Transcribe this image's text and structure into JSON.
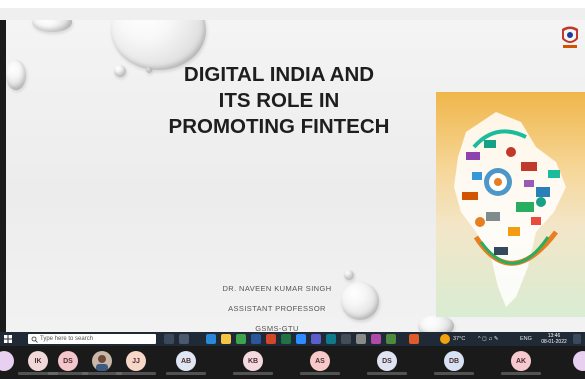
{
  "slide": {
    "title_lines": [
      "DIGITAL INDIA AND",
      "ITS ROLE IN",
      "PROMOTING FINTECH"
    ],
    "author_lines": [
      "DR. NAVEEN KUMAR SINGH",
      "ASSISTANT PROFESSOR",
      "GSMS-GTU"
    ]
  },
  "taskbar": {
    "search_placeholder": "Type here to search",
    "weather": "37°C",
    "tray_lang": "ENG",
    "time": "13:46",
    "date": "08-01-2022"
  },
  "participants": [
    {
      "initials": "IK",
      "color": "#f2d9d9"
    },
    {
      "initials": "DS",
      "color": "#f5c6cb"
    },
    {
      "initials": "",
      "color": "#c9b8a8"
    },
    {
      "initials": "JJ",
      "color": "#f7d7c8"
    },
    {
      "initials": "AB",
      "color": "#e1e6f5"
    },
    {
      "initials": "KB",
      "color": "#f5d9e0"
    },
    {
      "initials": "AS",
      "color": "#f7c9c9"
    },
    {
      "initials": "DS",
      "color": "#dfe4f2"
    },
    {
      "initials": "DB",
      "color": "#d8e2f5"
    },
    {
      "initials": "AK",
      "color": "#f5c9cf"
    }
  ],
  "colors": {
    "slide_text": "#1e1e1e",
    "taskbar_bg": "#1f2a36",
    "people_bg": "#1a1a1a"
  }
}
